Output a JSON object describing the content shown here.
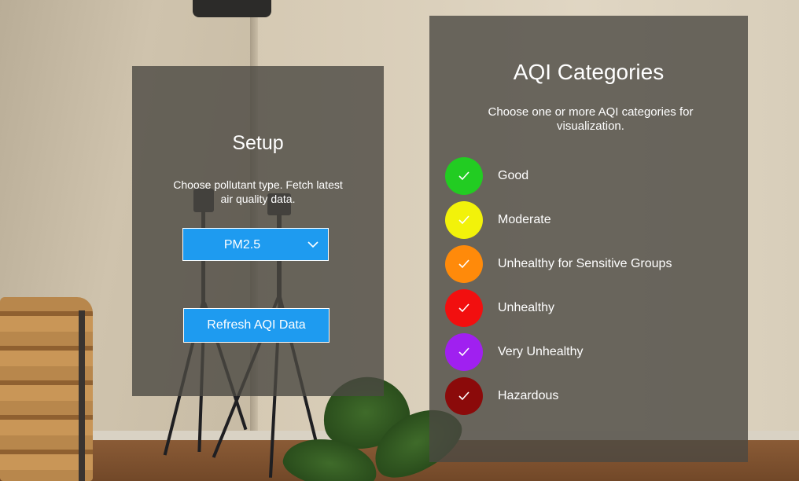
{
  "setup": {
    "title": "Setup",
    "description": "Choose pollutant type. Fetch latest air quality data.",
    "pollutant_dropdown": {
      "selected": "PM2.5",
      "icon": "chevron-down-icon"
    },
    "refresh_button_label": "Refresh AQI Data"
  },
  "aqi": {
    "title": "AQI Categories",
    "description": "Choose one or more AQI categories for visualization.",
    "categories": [
      {
        "label": "Good",
        "color": "#22cc22",
        "checked": true
      },
      {
        "label": "Moderate",
        "color": "#f2f20a",
        "checked": true
      },
      {
        "label": "Unhealthy for Sensitive Groups",
        "color": "#ff8a0a",
        "checked": true
      },
      {
        "label": "Unhealthy",
        "color": "#f20f0f",
        "checked": true
      },
      {
        "label": "Very Unhealthy",
        "color": "#a020f0",
        "checked": true
      },
      {
        "label": "Hazardous",
        "color": "#8b0a0a",
        "checked": true
      }
    ]
  },
  "colors": {
    "button_blue": "#1e9bf0",
    "panel_bg": "#4b4842"
  }
}
